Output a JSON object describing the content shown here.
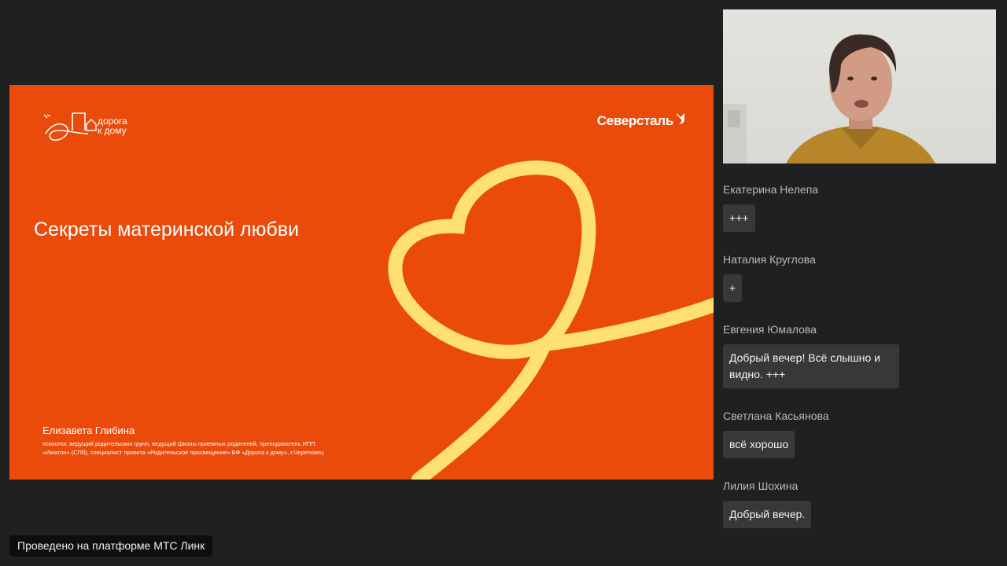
{
  "slide": {
    "title": "Секреты материнской любви",
    "logo_left": {
      "line1": "дорога",
      "line2": "к дому"
    },
    "logo_right": "Северсталь",
    "speaker_name": "Елизавета Глибина",
    "speaker_desc": "психолог, ведущий родительских групп, ведущий Школы приемных родителей, преподаватель ИПП «Иматон» (СПб), специалист проекта «Родительское просвещение» БФ «Дорога к дому», г.Череповец",
    "colors": {
      "background": "#ea4b0b",
      "accent": "#ffe173"
    }
  },
  "chat": {
    "messages": [
      {
        "author": "Екатерина Нелепа",
        "text": "+++"
      },
      {
        "author": "Наталия Круглова",
        "text": "+"
      },
      {
        "author": "Евгения Юмалова",
        "text": "Добрый вечер! Всё слышно и видно. +++"
      },
      {
        "author": "Светлана Касьянова",
        "text": "всё хорошо"
      },
      {
        "author": "Лилия Шохина",
        "text": "Добрый вечер."
      }
    ]
  },
  "footer": {
    "platform": "Проведено на платформе МТС Линк"
  }
}
